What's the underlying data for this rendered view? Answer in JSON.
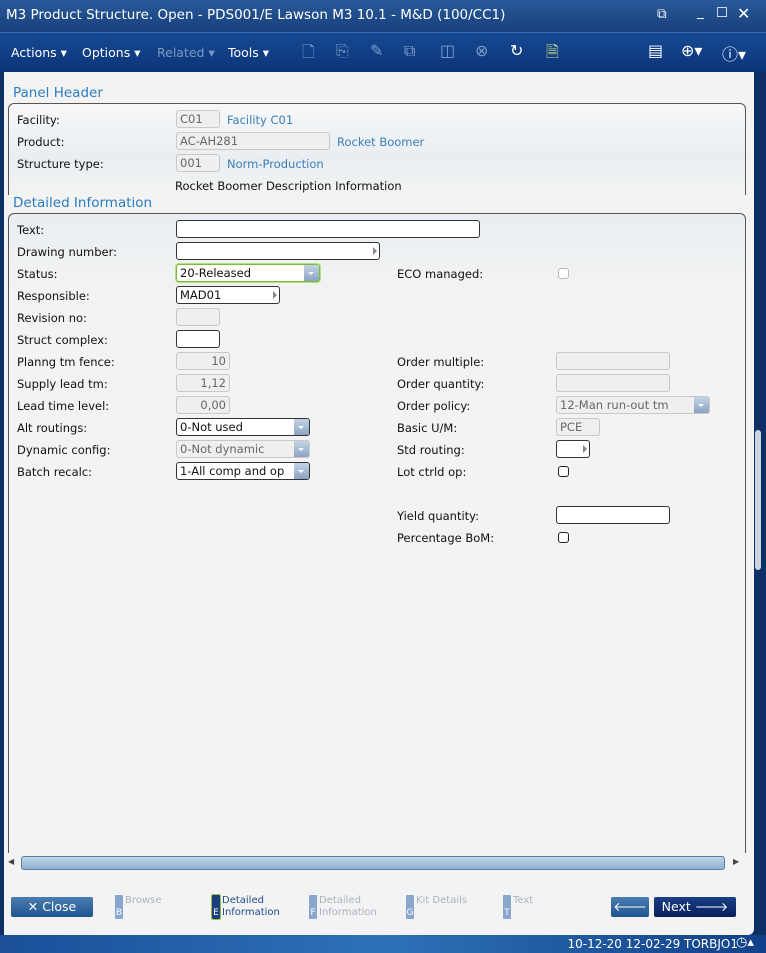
{
  "window": {
    "title": "M3 Product Structure. Open - PDS001/E   Lawson M3 10.1  - M&D  (100/CC1)"
  },
  "menu": {
    "actions": "Actions",
    "options": "Options",
    "related": "Related",
    "tools": "Tools"
  },
  "panel_header": {
    "title": "Panel Header",
    "facility_label": "Facility:",
    "facility_value": "C01",
    "facility_desc": "Facility C01",
    "product_label": "Product:",
    "product_value": "AC-AH281",
    "product_desc": "Rocket Boomer",
    "structure_label": "Structure type:",
    "structure_value": "001",
    "structure_desc": "Norm-Production",
    "description": "Rocket Boomer Description Information"
  },
  "detail": {
    "title": "Detailed Information",
    "text_label": "Text:",
    "text_value": "",
    "drawing_label": "Drawing number:",
    "drawing_value": "",
    "status_label": "Status:",
    "status_value": "20-Released",
    "eco_label": "ECO managed:",
    "eco_checked": false,
    "responsible_label": "Responsible:",
    "responsible_value": "MAD01",
    "revision_label": "Revision no:",
    "revision_value": "",
    "struct_label": "Struct complex:",
    "struct_value": "",
    "planng_label": "Planng tm fence:",
    "planng_value": "10",
    "supply_label": "Supply lead tm:",
    "supply_value": "1,12",
    "leadlvl_label": "Lead time level:",
    "leadlvl_value": "0,00",
    "alt_label": "Alt routings:",
    "alt_value": "0-Not used",
    "dyn_label": "Dynamic config:",
    "dyn_value": "0-Not dynamic",
    "batch_label": "Batch recalc:",
    "batch_value": "1-All comp and op",
    "ordmult_label": "Order multiple:",
    "ordmult_value": "",
    "ordqty_label": "Order quantity:",
    "ordqty_value": "",
    "policy_label": "Order policy:",
    "policy_value": "12-Man run-out tm",
    "um_label": "Basic U/M:",
    "um_value": "PCE",
    "stdrout_label": "Std routing:",
    "stdrout_value": "",
    "lot_label": "Lot ctrld op:",
    "lot_checked": false,
    "yield_label": "Yield quantity:",
    "yield_value": "",
    "pct_label": "Percentage BoM:",
    "pct_checked": false
  },
  "footer": {
    "close": "Close",
    "next": "Next",
    "steps": [
      {
        "key": "B",
        "label": "Browse",
        "active": false
      },
      {
        "key": "E",
        "label": "Detailed Information",
        "active": true
      },
      {
        "key": "F",
        "label": "Detailed Information",
        "active": false
      },
      {
        "key": "G",
        "label": "Kit Details",
        "active": false
      },
      {
        "key": "T",
        "label": "Text",
        "active": false
      }
    ]
  },
  "status_bar": {
    "text": "10-12-20 12-02-29 TORBJO1"
  }
}
